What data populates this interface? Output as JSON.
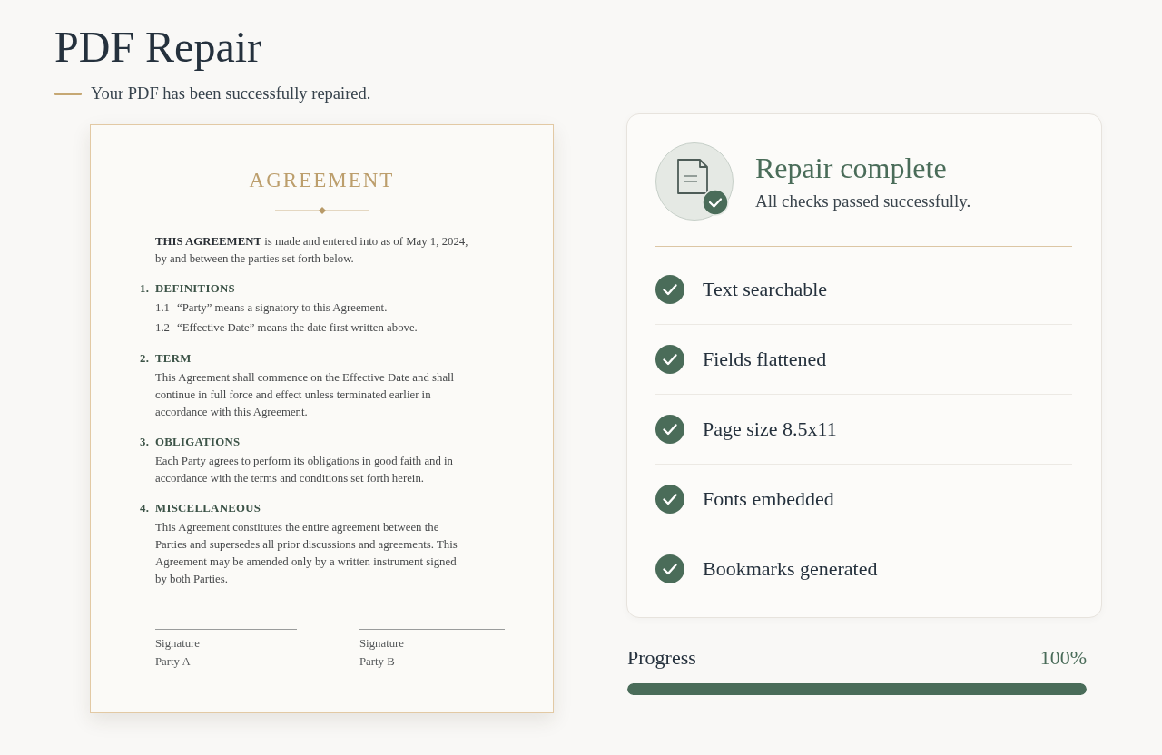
{
  "header": {
    "title": "PDF Repair",
    "subtitle": "Your PDF has been successfully repaired."
  },
  "document": {
    "title": "AGREEMENT",
    "intro": "**THIS AGREEMENT** is made and entered into as of May 1, 2024, by and between the parties set forth below.",
    "sections": [
      {
        "number": "1.",
        "heading": "DEFINITIONS",
        "clauses": [
          {
            "number": "1.1",
            "text": "“Party” means a signatory to this Agreement."
          },
          {
            "number": "1.2",
            "text": "“Effective Date” means the date first written above."
          }
        ]
      },
      {
        "number": "2.",
        "heading": "TERM",
        "body": "This Agreement shall commence on the Effective Date and shall continue in full force and effect unless terminated earlier in accordance with this Agreement."
      },
      {
        "number": "3.",
        "heading": "OBLIGATIONS",
        "body": "Each Party agrees to perform its obligations in good faith and in accordance with the terms and conditions set forth herein."
      },
      {
        "number": "4.",
        "heading": "MISCELLANEOUS",
        "body": "This Agreement constitutes the entire agreement between the Parties and supersedes all prior discussions and agreements. This Agreement may be amended only by a written instrument signed by both Parties."
      }
    ],
    "signatures": [
      {
        "label": "Signature",
        "party": "Party A"
      },
      {
        "label": "Signature",
        "party": "Party B"
      }
    ]
  },
  "status": {
    "title": "Repair complete",
    "message": "All checks passed successfully.",
    "checks": [
      {
        "label": "Text searchable",
        "passed": true
      },
      {
        "label": "Fields flattened",
        "passed": true
      },
      {
        "label": "Page size 8.5x11",
        "passed": true
      },
      {
        "label": "Fonts embedded",
        "passed": true
      },
      {
        "label": "Bookmarks generated",
        "passed": true
      }
    ]
  },
  "progress": {
    "label": "Progress",
    "reading": "100%",
    "level": 1
  }
}
